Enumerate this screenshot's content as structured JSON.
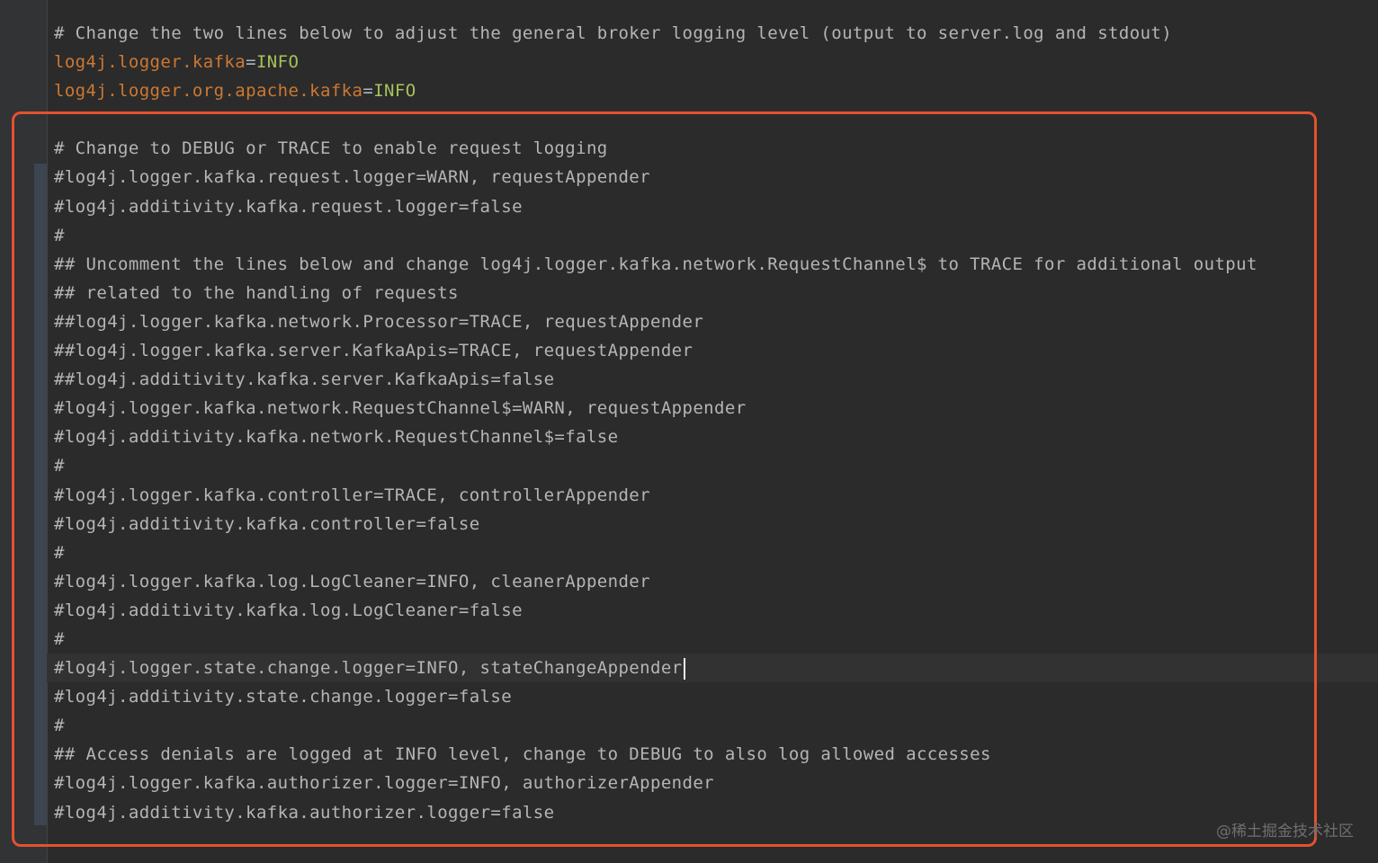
{
  "editor": {
    "lines": [
      {
        "type": "comment",
        "text": "# Change the two lines below to adjust the general broker logging level (output to server.log and stdout)"
      },
      {
        "type": "property",
        "key": "log4j.logger.kafka",
        "value": "INFO"
      },
      {
        "type": "property",
        "key": "log4j.logger.org.apache.kafka",
        "value": "INFO"
      },
      {
        "type": "comment",
        "text": ""
      },
      {
        "type": "comment",
        "text": "# Change to DEBUG or TRACE to enable request logging"
      },
      {
        "type": "comment",
        "text": "#log4j.logger.kafka.request.logger=WARN, requestAppender"
      },
      {
        "type": "comment",
        "text": "#log4j.additivity.kafka.request.logger=false"
      },
      {
        "type": "comment",
        "text": "#"
      },
      {
        "type": "comment",
        "text": "## Uncomment the lines below and change log4j.logger.kafka.network.RequestChannel$ to TRACE for additional output"
      },
      {
        "type": "comment",
        "text": "## related to the handling of requests"
      },
      {
        "type": "comment",
        "text": "##log4j.logger.kafka.network.Processor=TRACE, requestAppender"
      },
      {
        "type": "comment",
        "text": "##log4j.logger.kafka.server.KafkaApis=TRACE, requestAppender"
      },
      {
        "type": "comment",
        "text": "##log4j.additivity.kafka.server.KafkaApis=false"
      },
      {
        "type": "comment",
        "text": "#log4j.logger.kafka.network.RequestChannel$=WARN, requestAppender"
      },
      {
        "type": "comment",
        "text": "#log4j.additivity.kafka.network.RequestChannel$=false"
      },
      {
        "type": "comment",
        "text": "#"
      },
      {
        "type": "comment",
        "text": "#log4j.logger.kafka.controller=TRACE, controllerAppender"
      },
      {
        "type": "comment",
        "text": "#log4j.additivity.kafka.controller=false"
      },
      {
        "type": "comment",
        "text": "#"
      },
      {
        "type": "comment",
        "text": "#log4j.logger.kafka.log.LogCleaner=INFO, cleanerAppender"
      },
      {
        "type": "comment",
        "text": "#log4j.additivity.kafka.log.LogCleaner=false"
      },
      {
        "type": "comment",
        "text": "#"
      },
      {
        "type": "comment",
        "text": "#log4j.logger.state.change.logger=INFO, stateChangeAppender",
        "current": true
      },
      {
        "type": "comment",
        "text": "#log4j.additivity.state.change.logger=false"
      },
      {
        "type": "comment",
        "text": "#"
      },
      {
        "type": "comment",
        "text": "## Access denials are logged at INFO level, change to DEBUG to also log allowed accesses"
      },
      {
        "type": "comment",
        "text": "#log4j.logger.kafka.authorizer.logger=INFO, authorizerAppender"
      },
      {
        "type": "comment",
        "text": "#log4j.additivity.kafka.authorizer.logger=false"
      }
    ]
  },
  "watermark": "@稀土掘金技术社区",
  "colors": {
    "background": "#2b2b2b",
    "comment": "#b5b5b5",
    "key": "#cc7832",
    "value": "#a5c25c",
    "highlight_box": "#e4512f"
  }
}
